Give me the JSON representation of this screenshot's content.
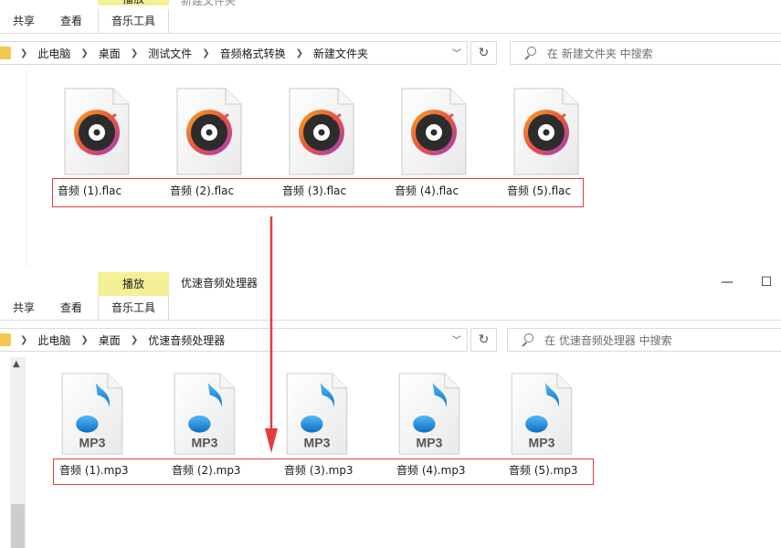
{
  "top_window": {
    "context_tab": "播放",
    "title": "新建文件夹",
    "ribbon_tabs": [
      "共享",
      "查看",
      "音乐工具"
    ],
    "breadcrumbs": [
      "此电脑",
      "桌面",
      "测试文件",
      "音频格式转换",
      "新建文件夹"
    ],
    "search_placeholder": "在 新建文件夹 中搜索",
    "files": [
      "音频 (1).flac",
      "音频 (2).flac",
      "音频 (3).flac",
      "音频 (4).flac",
      "音频 (5).flac"
    ]
  },
  "bottom_window": {
    "context_tab": "播放",
    "title": "优速音频处理器",
    "ribbon_tabs": [
      "共享",
      "查看",
      "音乐工具"
    ],
    "breadcrumbs": [
      "此电脑",
      "桌面",
      "优速音频处理器"
    ],
    "search_placeholder": "在 优速音频处理器 中搜索",
    "file_badge": "MP3",
    "files": [
      "音频 (1).mp3",
      "音频 (2).mp3",
      "音频 (3).mp3",
      "音频 (4).mp3",
      "音频 (5).mp3"
    ]
  },
  "colors": {
    "annotation_red": "#e43c3c",
    "context_tab_yellow": "#f3f095",
    "folder": "#f4c84e",
    "note_blue": "#1e8fe0"
  },
  "icons": {
    "flac_file": "music-disc-icon",
    "mp3_file": "music-note-icon"
  }
}
